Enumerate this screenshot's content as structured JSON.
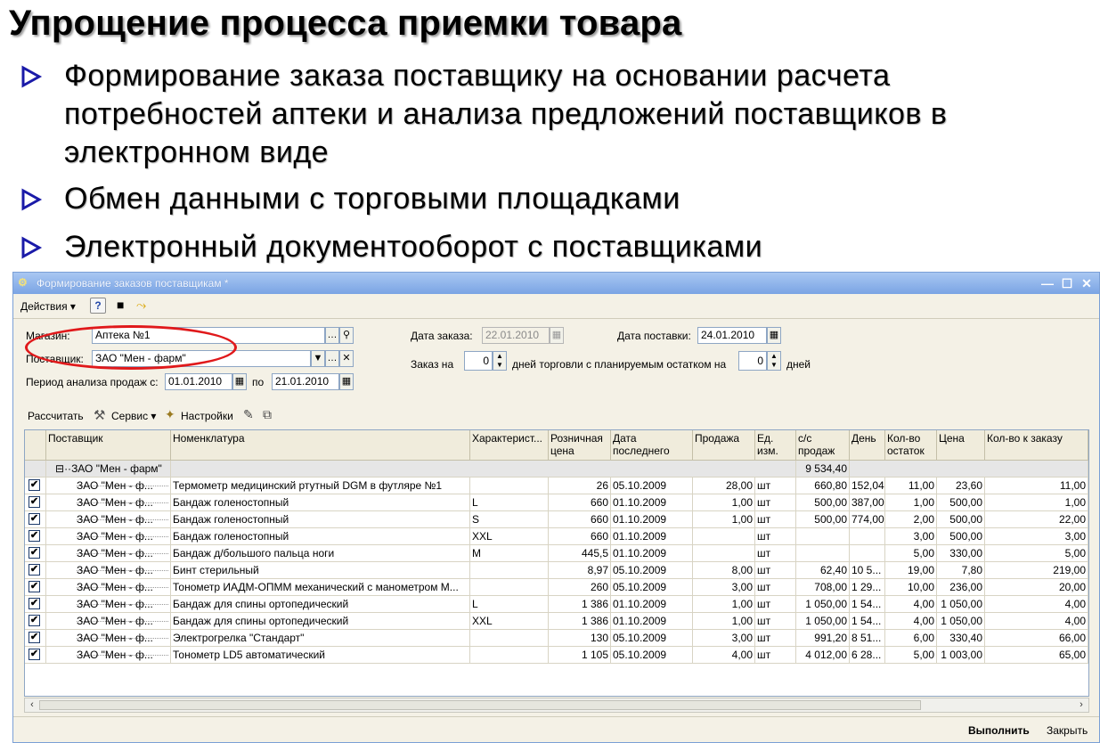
{
  "slide": {
    "title": "Упрощение процесса приемки товара",
    "bullets": [
      {
        "line1": "Формирование заказа поставщику на основании расчета",
        "line2": "потребностей аптеки и анализа предложений поставщиков в",
        "line3": "электронном виде"
      },
      {
        "line1": "Обмен данными с торговыми площадками"
      },
      {
        "line1": "Электронный документооборот с поставщиками"
      }
    ],
    "bullet_color": "#1a1aa8"
  },
  "window": {
    "title": "Формирование заказов поставщикам  *",
    "toolbar": {
      "actions": "Действия",
      "help_icon": "?"
    },
    "form": {
      "store_label": "Магазин:",
      "store_value": "Аптека №1",
      "supplier_label": "Поставщик:",
      "supplier_value": "ЗАО \"Мен - фарм\"",
      "period_label": "Период анализа продаж с:",
      "period_from": "01.01.2010",
      "period_to_label": "по",
      "period_to": "21.01.2010",
      "order_date_label": "Дата заказа:",
      "order_date": "22.01.2010",
      "delivery_date_label": "Дата поставки:",
      "delivery_date": "24.01.2010",
      "order_for_label": "Заказ на",
      "order_for_value": "0",
      "days_label": "дней торговли с планируемым остатком на",
      "stock_days_value": "0",
      "days_suffix": "дней"
    },
    "grid_toolbar": {
      "calculate": "Рассчитать",
      "service": "Сервис",
      "settings": "Настройки"
    },
    "columns": [
      "Поставщик",
      "Номенклатура",
      "Характерист...",
      "Розничная цена",
      "Дата последнего",
      "Продажа",
      "Ед. изм.",
      "с/с продаж",
      "День",
      "Кол-во остаток",
      "Цена",
      "Кол-во к заказу"
    ],
    "group_row": {
      "name": "ЗАО \"Мен - фарм\"",
      "total": "9 534,40"
    },
    "rows": [
      {
        "supplier": "ЗАО \"Мен - ф...",
        "item": "Термометр медицинский ртутный DGM в футляре №1",
        "char": "",
        "price": "26",
        "date": "05.10.2009",
        "sale": "28,00",
        "unit": "шт",
        "cost": "660,80",
        "day": "152,04",
        "rest": "11,00",
        "cprice": "23,60",
        "qty": "11,00"
      },
      {
        "supplier": "ЗАО \"Мен - ф...",
        "item": "Бандаж голеностопный",
        "char": "L",
        "price": "660",
        "date": "01.10.2009",
        "sale": "1,00",
        "unit": "шт",
        "cost": "500,00",
        "day": "387,00",
        "rest": "1,00",
        "cprice": "500,00",
        "qty": "1,00"
      },
      {
        "supplier": "ЗАО \"Мен - ф...",
        "item": "Бандаж голеностопный",
        "char": "S",
        "price": "660",
        "date": "01.10.2009",
        "sale": "1,00",
        "unit": "шт",
        "cost": "500,00",
        "day": "774,00",
        "rest": "2,00",
        "cprice": "500,00",
        "qty": "22,00"
      },
      {
        "supplier": "ЗАО \"Мен - ф...",
        "item": "Бандаж голеностопный",
        "char": "XXL",
        "price": "660",
        "date": "01.10.2009",
        "sale": "",
        "unit": "шт",
        "cost": "",
        "day": "",
        "rest": "3,00",
        "cprice": "500,00",
        "qty": "3,00"
      },
      {
        "supplier": "ЗАО \"Мен - ф...",
        "item": "Бандаж д/большого пальца ноги",
        "char": "M",
        "price": "445,5",
        "date": "01.10.2009",
        "sale": "",
        "unit": "шт",
        "cost": "",
        "day": "",
        "rest": "5,00",
        "cprice": "330,00",
        "qty": "5,00"
      },
      {
        "supplier": "ЗАО \"Мен - ф...",
        "item": "Бинт стерильный",
        "char": "",
        "price": "8,97",
        "date": "05.10.2009",
        "sale": "8,00",
        "unit": "шт",
        "cost": "62,40",
        "day": "10 5...",
        "rest": "19,00",
        "cprice": "7,80",
        "qty": "219,00"
      },
      {
        "supplier": "ЗАО \"Мен - ф...",
        "item": "Тонометр ИАДМ-ОПММ механический с манометром М...",
        "char": "",
        "price": "260",
        "date": "05.10.2009",
        "sale": "3,00",
        "unit": "шт",
        "cost": "708,00",
        "day": "1 29...",
        "rest": "10,00",
        "cprice": "236,00",
        "qty": "20,00"
      },
      {
        "supplier": "ЗАО \"Мен - ф...",
        "item": "Бандаж для спины ортопедический",
        "char": "L",
        "price": "1 386",
        "date": "01.10.2009",
        "sale": "1,00",
        "unit": "шт",
        "cost": "1 050,00",
        "day": "1 54...",
        "rest": "4,00",
        "cprice": "1 050,00",
        "qty": "4,00"
      },
      {
        "supplier": "ЗАО \"Мен - ф...",
        "item": "Бандаж для спины ортопедический",
        "char": "XXL",
        "price": "1 386",
        "date": "01.10.2009",
        "sale": "1,00",
        "unit": "шт",
        "cost": "1 050,00",
        "day": "1 54...",
        "rest": "4,00",
        "cprice": "1 050,00",
        "qty": "4,00"
      },
      {
        "supplier": "ЗАО \"Мен - ф...",
        "item": "Электрогрелка \"Стандарт\"",
        "char": "",
        "price": "130",
        "date": "05.10.2009",
        "sale": "3,00",
        "unit": "шт",
        "cost": "991,20",
        "day": "8 51...",
        "rest": "6,00",
        "cprice": "330,40",
        "qty": "66,00"
      },
      {
        "supplier": "ЗАО \"Мен - ф...",
        "item": "Тонометр LD5 автоматический",
        "char": "",
        "price": "1 105",
        "date": "05.10.2009",
        "sale": "4,00",
        "unit": "шт",
        "cost": "4 012,00",
        "day": "6 28...",
        "rest": "5,00",
        "cprice": "1 003,00",
        "qty": "65,00"
      }
    ],
    "buttons": {
      "execute": "Выполнить",
      "close": "Закрыть"
    }
  }
}
